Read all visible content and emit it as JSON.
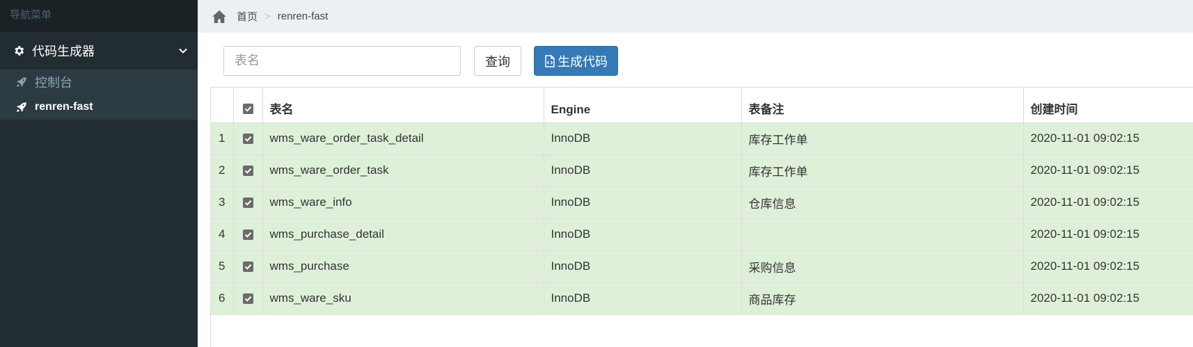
{
  "sidebar": {
    "header": "导航菜单",
    "menu_parent": "代码生成器",
    "items": [
      {
        "label": "控制台",
        "active": false
      },
      {
        "label": "renren-fast",
        "active": true
      }
    ]
  },
  "breadcrumb": {
    "home": "首页",
    "separator": ">",
    "current": "renren-fast"
  },
  "toolbar": {
    "search_placeholder": "表名",
    "search_value": "",
    "query_label": "查询",
    "generate_label": "生成代码"
  },
  "table": {
    "headers": [
      "表名",
      "Engine",
      "表备注",
      "创建时间"
    ],
    "rows": [
      {
        "num": "1",
        "name": "wms_ware_order_task_detail",
        "engine": "InnoDB",
        "comment": "库存工作单",
        "created": "2020-11-01 09:02:15"
      },
      {
        "num": "2",
        "name": "wms_ware_order_task",
        "engine": "InnoDB",
        "comment": "库存工作单",
        "created": "2020-11-01 09:02:15"
      },
      {
        "num": "3",
        "name": "wms_ware_info",
        "engine": "InnoDB",
        "comment": "仓库信息",
        "created": "2020-11-01 09:02:15"
      },
      {
        "num": "4",
        "name": "wms_purchase_detail",
        "engine": "InnoDB",
        "comment": "",
        "created": "2020-11-01 09:02:15"
      },
      {
        "num": "5",
        "name": "wms_purchase",
        "engine": "InnoDB",
        "comment": "采购信息",
        "created": "2020-11-01 09:02:15"
      },
      {
        "num": "6",
        "name": "wms_ware_sku",
        "engine": "InnoDB",
        "comment": "商品库存",
        "created": "2020-11-01 09:02:15"
      }
    ]
  },
  "colors": {
    "sidebar_bg": "#222d32",
    "submenu_bg": "#2c3b41",
    "primary": "#337ab7",
    "row_selected": "#dff0d8",
    "breadcrumb_bg": "#ecf0f5"
  }
}
